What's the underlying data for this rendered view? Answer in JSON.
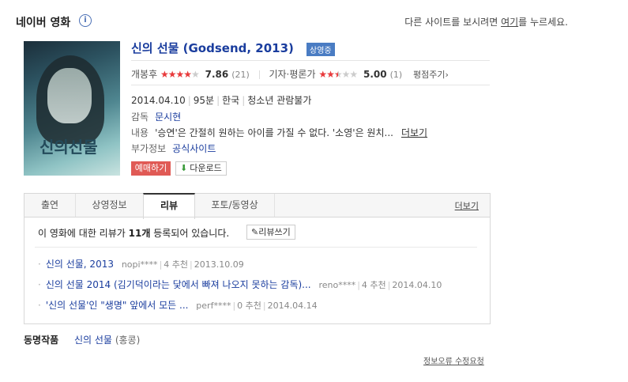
{
  "header": {
    "title": "네이버 영화",
    "info_icon": "i",
    "notice_before": "다른 사이트를 보시려면",
    "notice_link": "여기",
    "notice_after": "를 누르세요."
  },
  "poster": {
    "title": "신의선물"
  },
  "movie": {
    "title": "신의 선물 (Godsend, 2013)",
    "badge": "상영중",
    "audience_label": "개봉후",
    "audience_rating": 3.93,
    "audience_score": "7.86",
    "audience_count": "(21)",
    "critic_label": "기자·평론가",
    "critic_rating": 2.5,
    "critic_score": "5.00",
    "critic_count": "(1)",
    "rate_link": "평점주기",
    "release": "2014.04.10",
    "runtime": "95분",
    "country": "한국",
    "rating_grade": "청소년 관람불가",
    "director_label": "감독",
    "director": "문시현",
    "plot_label": "내용",
    "plot": "'승연'은 간절히 원하는 아이를 가질 수 없다. '소영'은 원치...",
    "plot_more": "더보기",
    "extra_label": "부가정보",
    "extra_link": "공식사이트",
    "book_button": "예매하기",
    "download_button": "다운로드"
  },
  "tabs": {
    "items": [
      "출연",
      "상영정보",
      "리뷰",
      "포토/동영상"
    ],
    "active_index": 2,
    "more": "더보기"
  },
  "reviews": {
    "summary_pre": "이 영화에 대한 리뷰가",
    "summary_count": "11개",
    "summary_post": "등록되어 있습니다.",
    "write_button": "리뷰쓰기",
    "items": [
      {
        "title": "신의 선물, 2013",
        "author": "nopi****",
        "recs": "4 추천",
        "date": "2013.10.09"
      },
      {
        "title": "신의 선물 2014 (김기덕이라는 닻에서 빠져 나오지 못하는 감독)...",
        "author": "reno****",
        "recs": "4 추천",
        "date": "2014.04.10"
      },
      {
        "title": "'신의 선물'인 \"생명\" 앞에서 모든 ...",
        "author": "perf****",
        "recs": "0 추천",
        "date": "2014.04.14"
      }
    ]
  },
  "same_title": {
    "label": "동명작품",
    "title": "신의 선물",
    "suffix": "(홍콩)"
  },
  "report_link": "정보오류 수정요청",
  "colors": {
    "link": "#1a3d9e",
    "star": "#e8393b",
    "badge": "#4a7cc3",
    "book": "#e05a55"
  }
}
